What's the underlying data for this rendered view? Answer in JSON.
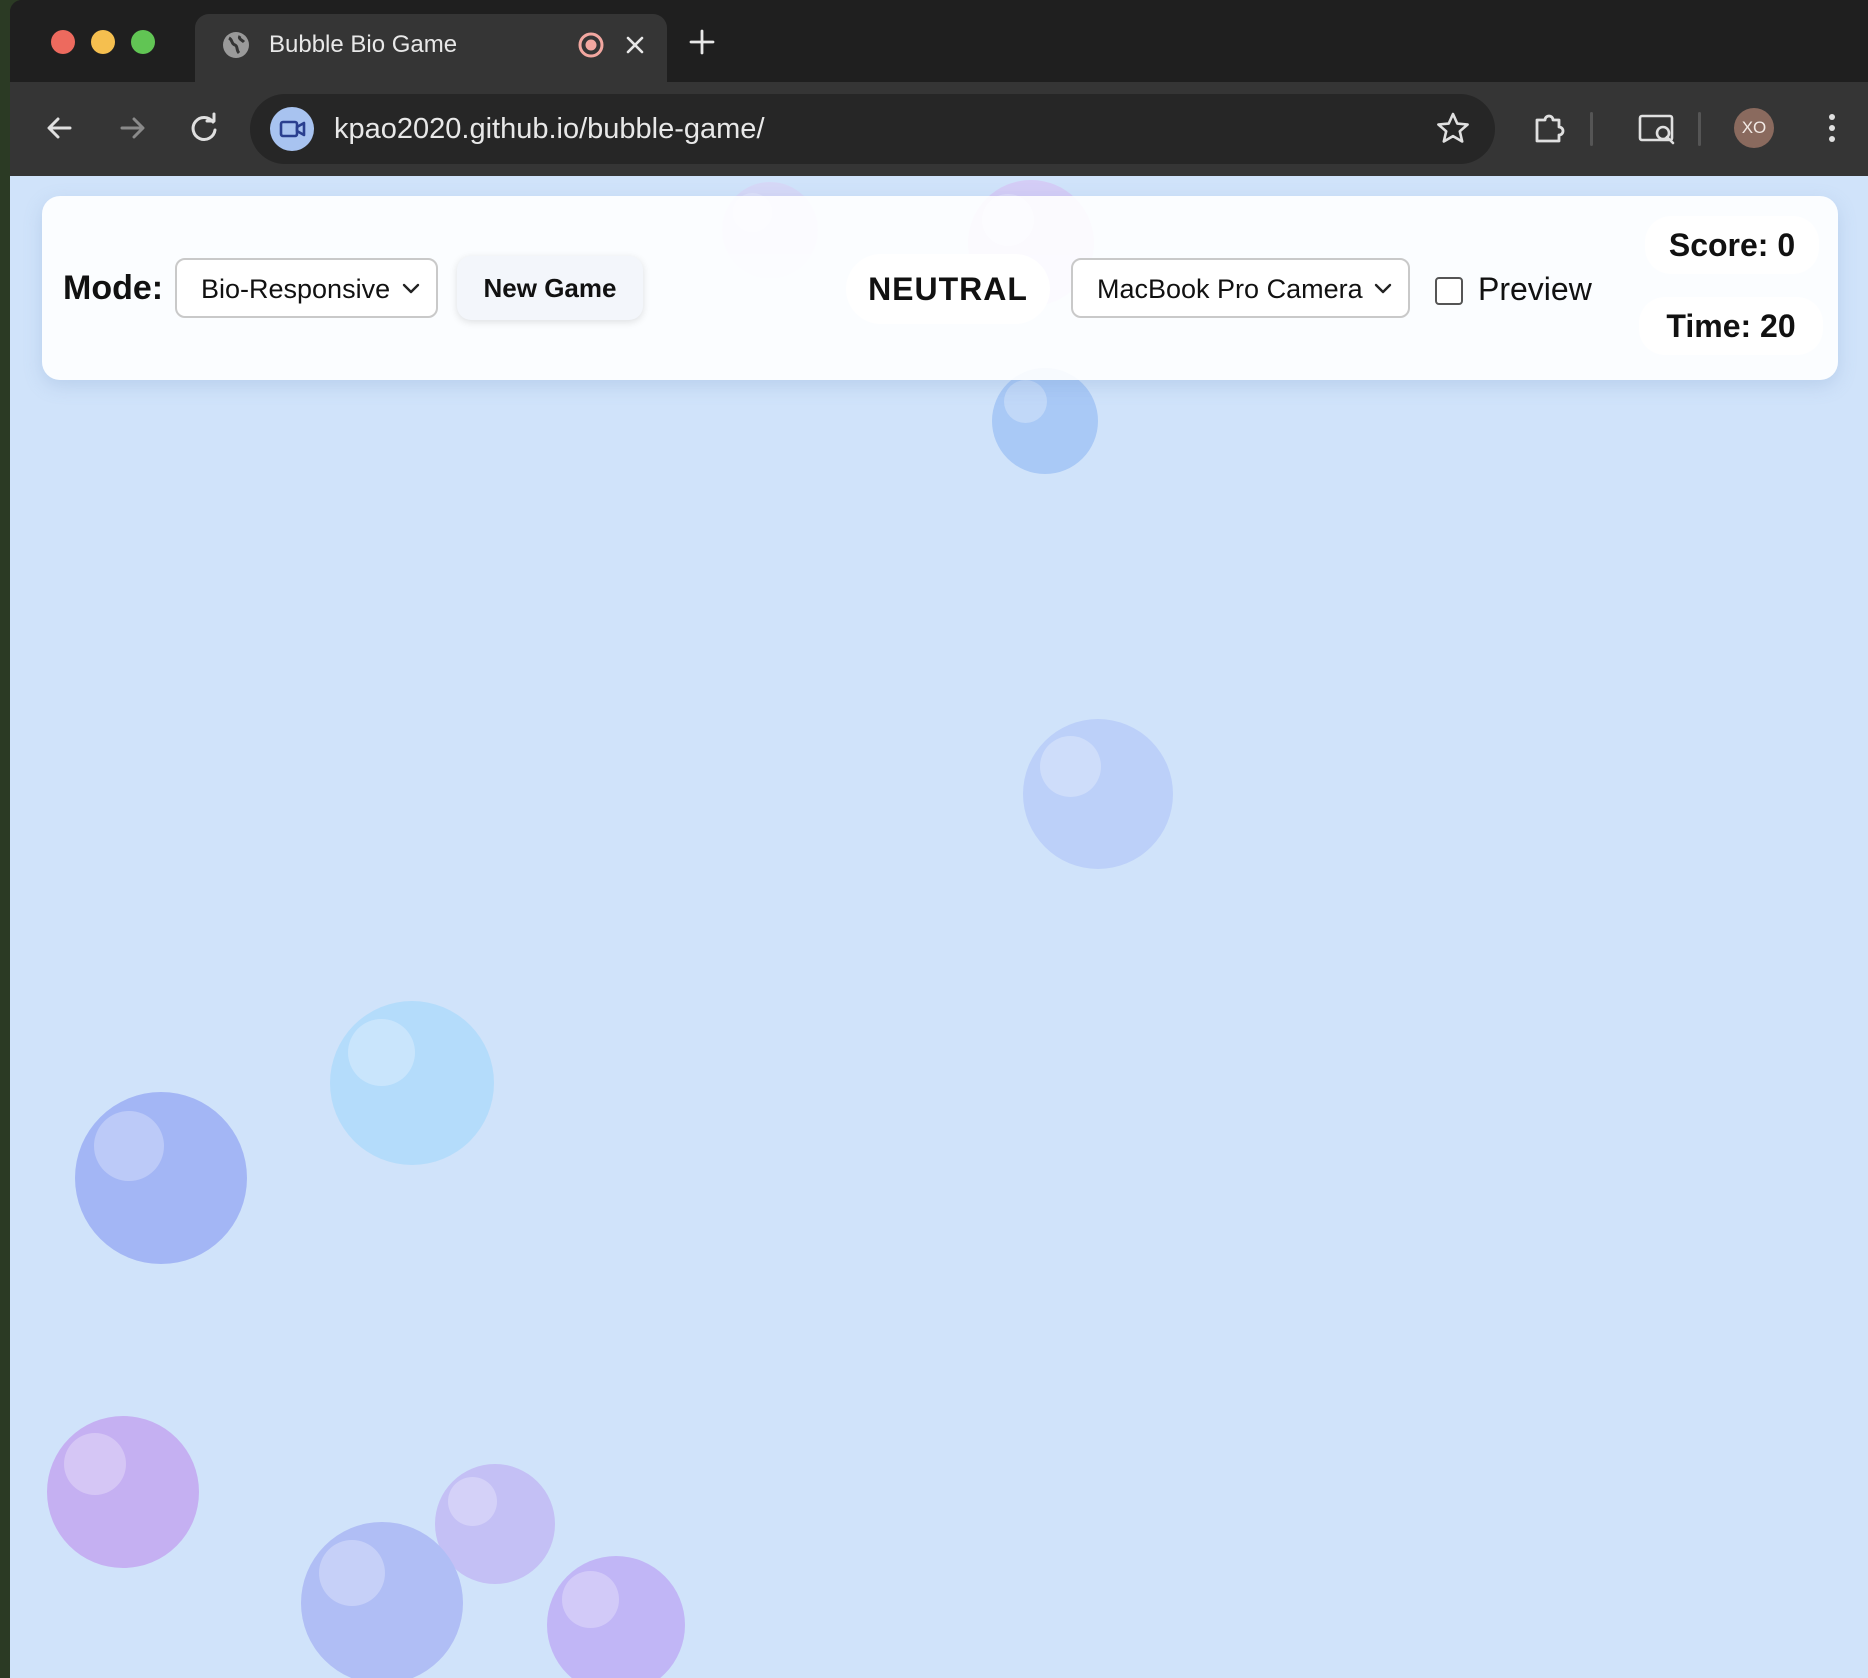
{
  "browser": {
    "tab": {
      "title": "Bubble Bio Game"
    },
    "address_bar": {
      "url": "kpao2020.github.io/bubble-game/"
    },
    "profile": {
      "initials": "XO"
    }
  },
  "game": {
    "controls": {
      "mode_label": "Mode:",
      "mode_selected": "Bio-Responsive",
      "new_game_label": "New Game",
      "emotion_state": "NEUTRAL",
      "camera_selected": "MacBook Pro Camera",
      "preview_label": "Preview",
      "preview_checked": false
    },
    "stats": {
      "score": "Score: 0",
      "time": "Time: 20"
    },
    "colors": {
      "background": "#d0e3fa",
      "bubble_blue": "#a9c9f6",
      "bubble_periwinkle": "#a3b6f5",
      "bubble_sky": "#b4dcfb",
      "bubble_lavender": "#c4b3f2",
      "bubble_purple": "#c5b0f2"
    }
  }
}
